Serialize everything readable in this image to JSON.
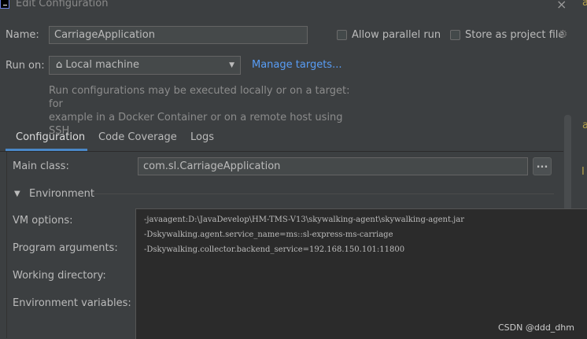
{
  "window": {
    "title": "Edit Configuration",
    "close_icon": "×"
  },
  "name": {
    "label": "Name:",
    "value": "CarriageApplication"
  },
  "options": {
    "allow_parallel_run": "Allow parallel run",
    "store_as_project_file": "Store as project file"
  },
  "run_on": {
    "label": "Run on:",
    "selected": "Local machine",
    "manage_targets": "Manage targets...",
    "help_line1": "Run configurations may be executed locally or on a target: for",
    "help_line2": "example in a Docker Container or on a remote host using SSH."
  },
  "tabs": [
    {
      "label": "Configuration",
      "active": true
    },
    {
      "label": "Code Coverage",
      "active": false
    },
    {
      "label": "Logs",
      "active": false
    }
  ],
  "main_class": {
    "label": "Main class:",
    "value": "com.sl.CarriageApplication",
    "browse_label": "..."
  },
  "environment": {
    "section_label": "Environment",
    "vm_options_label": "VM options:",
    "program_arguments_label": "Program arguments:",
    "working_directory_label": "Working directory:",
    "environment_variables_label": "Environment variables:"
  },
  "vm_options_popup": {
    "lines": [
      "-javaagent:D:\\JavaDevelop\\HM-TMS-V13\\skywalking-agent\\skywalking-agent.jar",
      "-Dskywalking.agent.service_name=ms::sl-express-ms-carriage",
      "-Dskywalking.collector.backend_service=192.168.150.101:11800"
    ]
  },
  "watermark": "CSDN @ddd_dhm",
  "background_editor": {
    "edge_chars": [
      "a",
      "a",
      "I"
    ]
  },
  "colors": {
    "link": "#589df6",
    "tab_underline": "#4a88c7",
    "background": "#3c3f41",
    "popup": "#2b2b2b"
  }
}
